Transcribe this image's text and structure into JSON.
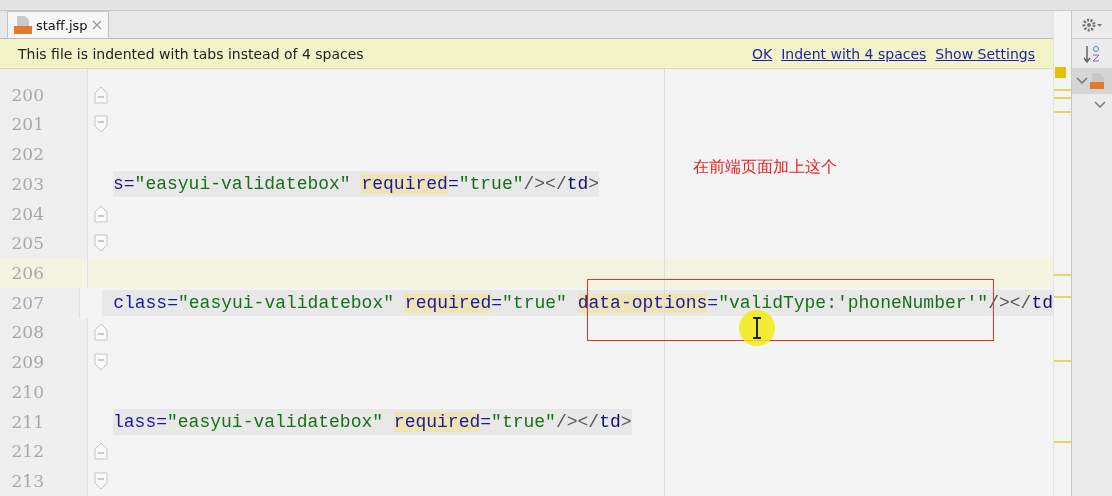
{
  "tab": {
    "label": "staff.jsp",
    "selected": true
  },
  "banner": {
    "message": "This file is indented with tabs instead of 4 spaces",
    "actions": [
      "OK",
      "Indent with 4 spaces",
      "Show Settings"
    ]
  },
  "lines": [
    {
      "number": "200",
      "current": false,
      "kind": "fold_end"
    },
    {
      "number": "201",
      "current": false,
      "kind": "fold_start"
    },
    {
      "number": "202",
      "current": false,
      "kind": "blank"
    },
    {
      "number": "203",
      "current": false,
      "kind": "code",
      "segments": [
        {
          "text": "s=",
          "kind": "attr",
          "highlight": false
        },
        {
          "text": "\"easyui-validatebox\" ",
          "kind": "value",
          "highlight": false
        },
        {
          "text": "required",
          "kind": "attr",
          "highlight": true
        },
        {
          "text": "=",
          "kind": "attr",
          "highlight": false
        },
        {
          "text": "\"true\"",
          "kind": "value",
          "highlight": false
        },
        {
          "text": "/></",
          "kind": "punct",
          "highlight": false
        },
        {
          "text": "td",
          "kind": "tag",
          "highlight": false
        },
        {
          "text": ">",
          "kind": "punct",
          "highlight": false
        }
      ]
    },
    {
      "number": "204",
      "current": false,
      "kind": "fold_end"
    },
    {
      "number": "205",
      "current": false,
      "kind": "fold_start"
    },
    {
      "number": "206",
      "current": true,
      "kind": "blank"
    },
    {
      "number": "207",
      "current": false,
      "kind": "code",
      "segments": [
        {
          "text": " class=",
          "kind": "attr",
          "highlight": false
        },
        {
          "text": "\"easyui-validatebox\" ",
          "kind": "value",
          "highlight": false
        },
        {
          "text": "required",
          "kind": "attr",
          "highlight": true
        },
        {
          "text": "=",
          "kind": "attr",
          "highlight": false
        },
        {
          "text": "\"true\" ",
          "kind": "value",
          "highlight": false
        },
        {
          "text": "data-options",
          "kind": "attr",
          "highlight": true
        },
        {
          "text": "=",
          "kind": "attr",
          "highlight": false
        },
        {
          "text": "\"validType:'phoneNumber'\"",
          "kind": "value",
          "highlight": false
        },
        {
          "text": "/></",
          "kind": "punct",
          "highlight": false
        },
        {
          "text": "td",
          "kind": "tag",
          "highlight": false
        }
      ]
    },
    {
      "number": "208",
      "current": false,
      "kind": "fold_end"
    },
    {
      "number": "209",
      "current": false,
      "kind": "fold_start"
    },
    {
      "number": "210",
      "current": false,
      "kind": "blank"
    },
    {
      "number": "211",
      "current": false,
      "kind": "code",
      "segments": [
        {
          "text": "lass=",
          "kind": "attr",
          "highlight": false
        },
        {
          "text": "\"easyui-validatebox\" ",
          "kind": "value",
          "highlight": false
        },
        {
          "text": "required",
          "kind": "attr",
          "highlight": true
        },
        {
          "text": "=",
          "kind": "attr",
          "highlight": false
        },
        {
          "text": "\"true\"",
          "kind": "value",
          "highlight": false
        },
        {
          "text": "/></",
          "kind": "punct",
          "highlight": false
        },
        {
          "text": "td",
          "kind": "tag",
          "highlight": false
        },
        {
          "text": ">",
          "kind": "punct",
          "highlight": false
        }
      ]
    },
    {
      "number": "212",
      "current": false,
      "kind": "fold_end"
    },
    {
      "number": "213",
      "current": false,
      "kind": "fold_start"
    }
  ],
  "annotation": {
    "text": "在前端页面加上这个"
  }
}
